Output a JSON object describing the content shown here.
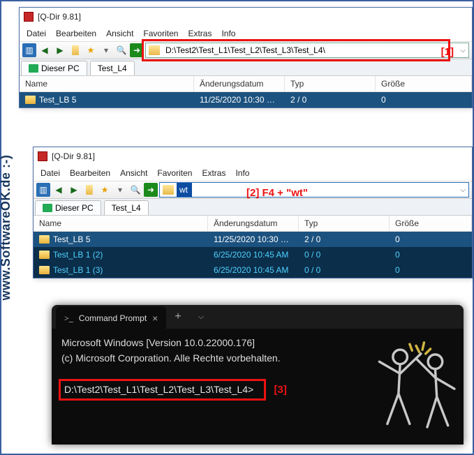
{
  "side_text": "www.SoftwareOK.de :-)",
  "watermark": "www.SoftwareOK.de :-)",
  "annotations": {
    "a1": "[1]",
    "a2": "[2] F4 + \"wt\"",
    "a3": "[3]"
  },
  "win1": {
    "title": "[Q-Dir 9.81]",
    "menu": [
      "Datei",
      "Bearbeiten",
      "Ansicht",
      "Favoriten",
      "Extras",
      "Info"
    ],
    "address": "D:\\Test2\\Test_L1\\Test_L2\\Test_L3\\Test_L4\\",
    "tabs": [
      "Dieser PC",
      "Test_L4"
    ],
    "cols": {
      "name": "Name",
      "date": "Änderungsdatum",
      "typ": "Typ",
      "size": "Größe"
    },
    "rows": [
      {
        "name": "Test_LB 5",
        "date": "11/25/2020 10:30 …",
        "typ": "2 / 0",
        "size": "0"
      }
    ]
  },
  "win2": {
    "title": "[Q-Dir 9.81]",
    "menu": [
      "Datei",
      "Bearbeiten",
      "Ansicht",
      "Favoriten",
      "Extras",
      "Info"
    ],
    "address": "wt",
    "tabs": [
      "Dieser PC",
      "Test_L4"
    ],
    "cols": {
      "name": "Name",
      "date": "Änderungsdatum",
      "typ": "Typ",
      "size": "Größe"
    },
    "rows": [
      {
        "name": "Test_LB 5",
        "date": "11/25/2020 10:30 …",
        "typ": "2 / 0",
        "size": "0"
      },
      {
        "name": "Test_LB 1 (2)",
        "date": "6/25/2020 10:45 AM",
        "typ": "0 / 0",
        "size": "0"
      },
      {
        "name": "Test_LB 1 (3)",
        "date": "6/25/2020 10:45 AM",
        "typ": "0 / 0",
        "size": "0"
      }
    ]
  },
  "terminal": {
    "tab": "Command Prompt",
    "line1": "Microsoft Windows [Version 10.0.22000.176]",
    "line2": "(c) Microsoft Corporation. Alle Rechte vorbehalten.",
    "prompt": "D:\\Test2\\Test_L1\\Test_L2\\Test_L3\\Test_L4>"
  }
}
